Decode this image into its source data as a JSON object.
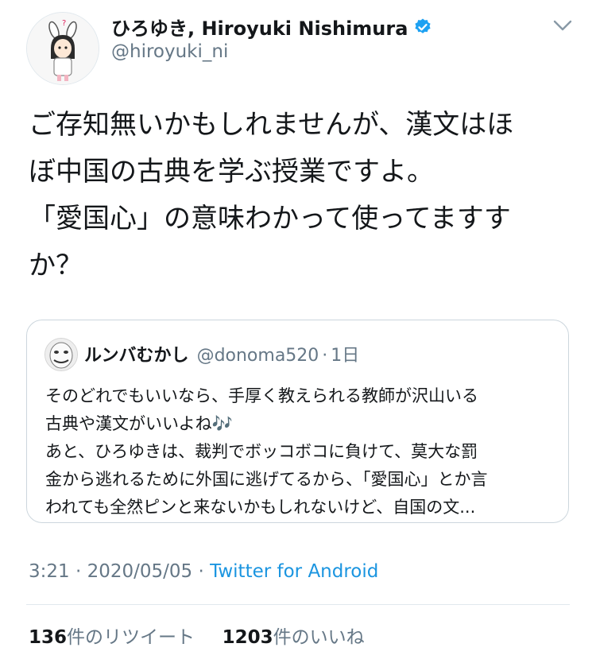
{
  "author": {
    "display_name": "ひろゆき, Hiroyuki Nishimura",
    "handle": "@hiroyuki_ni",
    "verified": true
  },
  "tweet": {
    "text_lines": [
      "ご存知無いかもしれませんが、漢文はほ",
      "ぼ中国の古典を学ぶ授業ですよ。",
      "「愛国心」の意味わかって使ってますす",
      "か？"
    ]
  },
  "quoted_tweet": {
    "display_name": "ルンバむかし",
    "handle": "@donoma520",
    "separator": "·",
    "time": "1日",
    "text_lines": [
      "そのどれでもいいなら、手厚く教えられる教師が沢山いる",
      "古典や漢文がいいよね🎶",
      "あと、ひろゆきは、裁判でボッコボコに負けて、莫大な罰",
      "金から逃れるために外国に逃げてるから、「愛国心」とか言",
      "われても全然ピンと来ないかもしれないけど、自国の文..."
    ]
  },
  "meta": {
    "time": "3:21",
    "date": "2020/05/05",
    "separator": "·",
    "source": "Twitter for Android"
  },
  "stats": {
    "retweets": "136",
    "retweets_label": "件のリツイート",
    "likes": "1203",
    "likes_label": "件のいいね"
  },
  "colors": {
    "text": "#14171a",
    "secondary": "#657786",
    "link": "#1b95e0",
    "verified": "#1da1f2",
    "border": "#ccd6dd"
  }
}
